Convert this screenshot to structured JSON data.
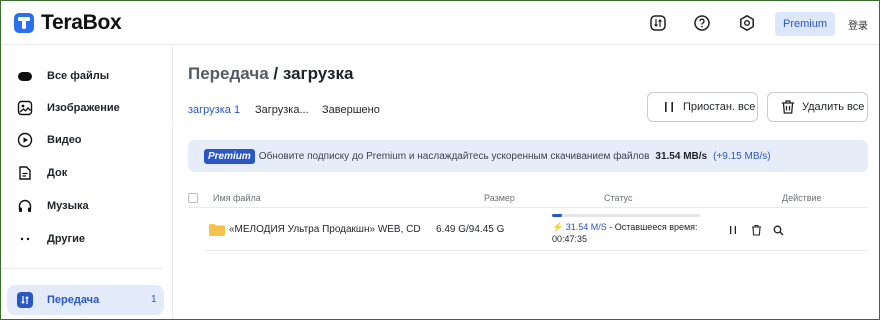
{
  "app": {
    "name": "TeraBox"
  },
  "topbar": {
    "premium_label": "Premium",
    "login_label": "登录"
  },
  "sidebar": {
    "items": [
      {
        "label": "Все файлы",
        "icon": "all-files-icon"
      },
      {
        "label": "Изображение",
        "icon": "image-icon"
      },
      {
        "label": "Видео",
        "icon": "video-icon"
      },
      {
        "label": "Док",
        "icon": "doc-icon"
      },
      {
        "label": "Музыка",
        "icon": "music-icon"
      },
      {
        "label": "Другие",
        "icon": "more-icon"
      }
    ],
    "transfer": {
      "label": "Передача",
      "count": "1"
    }
  },
  "page": {
    "title_prefix": "Передача",
    "title_sep": "/",
    "title_current": "загрузка",
    "tabs": [
      {
        "label": "загрузка 1",
        "active": true
      },
      {
        "label": "Загрузка...",
        "active": false
      },
      {
        "label": "Завершено",
        "active": false
      }
    ],
    "pause_all_label": "Приостан. все",
    "delete_all_label": "Удалить все"
  },
  "banner": {
    "badge": "Premium",
    "message": "Обновите подписку до Premium и наслаждайтесь ускоренным скачиванием файлов",
    "speed": "31.54 MB/s",
    "gain": "(+9.15 MB/s)"
  },
  "table": {
    "headers": {
      "name": "Имя файла",
      "size": "Размер",
      "status": "Статус",
      "action": "Действие"
    },
    "rows": [
      {
        "name": "«МЕЛОДИЯ Ультра Продакшн» WEB, CD",
        "size": "6.49 G/94.45 G",
        "progress": 0.07,
        "speed": "31.54 M/S",
        "remaining_label": "- Оставшееся время:",
        "remaining": "00:47:35"
      }
    ]
  },
  "colors": {
    "accent": "#2a56c6",
    "banner_bg": "#e6edf9",
    "folder": "#f5c24b"
  }
}
